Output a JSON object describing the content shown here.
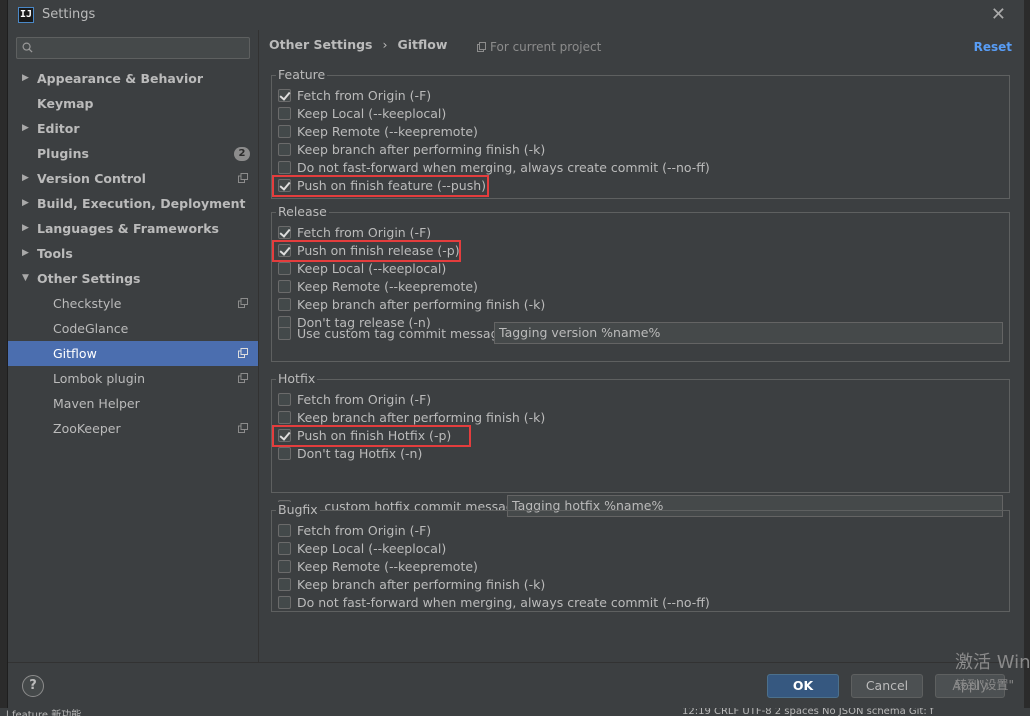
{
  "window": {
    "title": "Settings",
    "app_icon": "IJ"
  },
  "search": {
    "placeholder": "",
    "value": ""
  },
  "sidebar": {
    "items": [
      {
        "label": "Appearance & Behavior",
        "arrow": "▶",
        "bold": true
      },
      {
        "label": "Keymap",
        "bold": true
      },
      {
        "label": "Editor",
        "arrow": "▶",
        "bold": true
      },
      {
        "label": "Plugins",
        "bold": true,
        "badge": "2"
      },
      {
        "label": "Version Control",
        "arrow": "▶",
        "bold": true,
        "project_icon": true
      },
      {
        "label": "Build, Execution, Deployment",
        "arrow": "▶",
        "bold": true
      },
      {
        "label": "Languages & Frameworks",
        "arrow": "▶",
        "bold": true
      },
      {
        "label": "Tools",
        "arrow": "▶",
        "bold": true
      },
      {
        "label": "Other Settings",
        "arrow": "▼",
        "bold": true
      },
      {
        "label": "Checkstyle",
        "child": true,
        "project_icon": true
      },
      {
        "label": "CodeGlance",
        "child": true
      },
      {
        "label": "Gitflow",
        "child": true,
        "selected": true,
        "project_icon": true
      },
      {
        "label": "Lombok plugin",
        "child": true,
        "project_icon": true
      },
      {
        "label": "Maven Helper",
        "child": true
      },
      {
        "label": "ZooKeeper",
        "child": true,
        "project_icon": true
      }
    ]
  },
  "header": {
    "breadcrumb_parent": "Other Settings",
    "breadcrumb_sep": "›",
    "breadcrumb_current": "Gitflow",
    "scope": "For current project",
    "reset": "Reset"
  },
  "feature": {
    "title": "Feature",
    "options": [
      {
        "label": "Fetch from Origin (-F)",
        "checked": true
      },
      {
        "label": "Keep Local (--keeplocal)",
        "checked": false
      },
      {
        "label": "Keep Remote (--keepremote)",
        "checked": false
      },
      {
        "label": "Keep branch after performing finish (-k)",
        "checked": false
      },
      {
        "label": "Do not fast-forward when merging, always create commit (--no-ff)",
        "checked": false
      },
      {
        "label": "Push on finish feature (--push)",
        "checked": true
      }
    ]
  },
  "release": {
    "title": "Release",
    "options": [
      {
        "label": "Fetch from Origin (-F)",
        "checked": true
      },
      {
        "label": "Push on finish release (-p)",
        "checked": true
      },
      {
        "label": "Keep Local (--keeplocal)",
        "checked": false
      },
      {
        "label": "Keep Remote (--keepremote)",
        "checked": false
      },
      {
        "label": "Keep branch after performing finish (-k)",
        "checked": false
      },
      {
        "label": "Don't tag release (-n)",
        "checked": false
      }
    ],
    "custom_label": "Use custom tag commit message",
    "custom_value": "Tagging version %name%"
  },
  "hotfix": {
    "title": "Hotfix",
    "options": [
      {
        "label": "Fetch from Origin (-F)",
        "checked": false
      },
      {
        "label": "Keep branch after performing finish (-k)",
        "checked": false
      },
      {
        "label": "Push on finish Hotfix (-p)",
        "checked": true
      },
      {
        "label": "Don't tag Hotfix (-n)",
        "checked": false
      }
    ],
    "custom_label": "Use custom hotfix commit message",
    "custom_value": "Tagging hotfix %name%"
  },
  "bugfix": {
    "title": "Bugfix",
    "options": [
      {
        "label": "Fetch from Origin (-F)",
        "checked": false
      },
      {
        "label": "Keep Local (--keeplocal)",
        "checked": false
      },
      {
        "label": "Keep Remote (--keepremote)",
        "checked": false
      },
      {
        "label": "Keep branch after performing finish (-k)",
        "checked": false
      },
      {
        "label": "Do not fast-forward when merging, always create commit (--no-ff)",
        "checked": false
      }
    ]
  },
  "footer": {
    "help": "?",
    "ok": "OK",
    "cancel": "Cancel",
    "apply": "Apply"
  },
  "watermark": {
    "line1": "激活 Win",
    "line2": "转到\"设置\""
  },
  "statusbar": {
    "left": "l feature 新功能 ... ",
    "right": "12:19   CRLF   UTF-8   2 spaces   No JSON schema   Git: f"
  },
  "colors": {
    "accent": "#4b6eaf",
    "link": "#589df6",
    "highlight": "#e43d3d",
    "ok_button": "#365880"
  }
}
